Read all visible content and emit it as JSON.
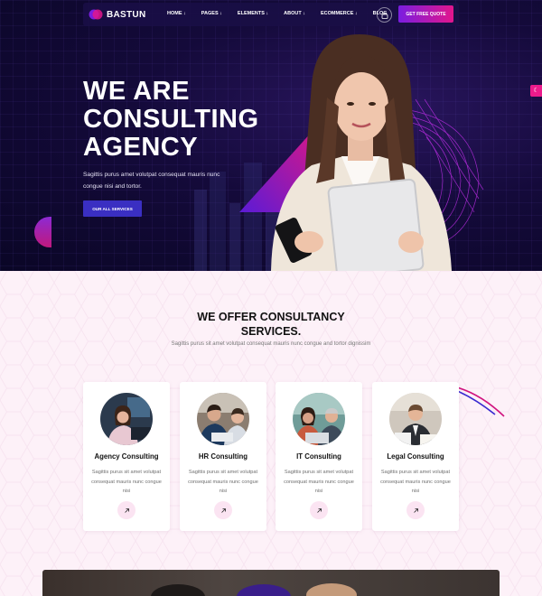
{
  "brand": {
    "name": "BASTUN"
  },
  "nav": {
    "items": [
      "HOME",
      "PAGES",
      "ELEMENTS",
      "ABOUT",
      "ECOMMERCE",
      "BLOG"
    ],
    "dropdown_marker": "↓",
    "cta_label": "GET FREE QUOTE"
  },
  "hero": {
    "title_lines": [
      "WE ARE",
      "CONSULTING",
      "AGENCY"
    ],
    "subtitle": "Sagittis purus amet volutpat consequat mauris nunc congue nisi and tortor.",
    "button_label": "OUR ALL SERVICES"
  },
  "services": {
    "title_lines": [
      "WE OFFER CONSULTANCY",
      "SERVICES."
    ],
    "subtitle": "Sagittis purus sit amet volutpat consequat mauris nunc congue and tortor dignissim",
    "cards": [
      {
        "title": "Agency Consulting",
        "text": "Sagittis purus sit amet volutpat consequat mauris nunc congue nisi"
      },
      {
        "title": "HR Consulting",
        "text": "Sagittis purus sit amet volutpat consequat mauris nunc congue nisi"
      },
      {
        "title": "IT Consulting",
        "text": "Sagittis purus sit amet volutpat consequat mauris nunc congue nisi"
      },
      {
        "title": "Legal Consulting",
        "text": "Sagittis purus sit amet volutpat consequat mauris nunc congue nisi"
      }
    ]
  },
  "icons": [
    "logo-mark-icon",
    "shopping-bag-icon",
    "arrow-up-right-icon",
    "settings-toggle-icon"
  ],
  "colors": {
    "accent_pink": "#e2168c",
    "accent_purple": "#7a1de0",
    "button_blue": "#3a2fc2",
    "hero_bg": "#140a3a",
    "section_bg": "#fdf1f8"
  }
}
